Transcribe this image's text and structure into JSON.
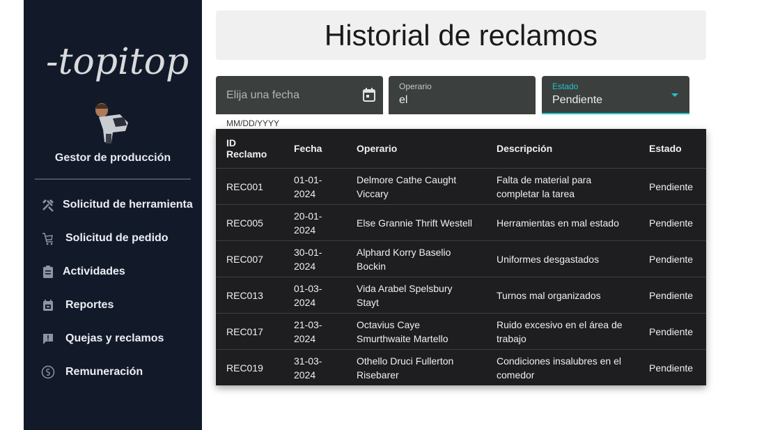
{
  "brand": {
    "logo_text": "-topitop"
  },
  "user": {
    "role": "Gestor de producción"
  },
  "nav": [
    {
      "label": "Solicitud de herramienta",
      "icon": "tools-icon"
    },
    {
      "label": "Solicitud de pedido",
      "icon": "cart-icon"
    },
    {
      "label": "Actividades",
      "icon": "clipboard-icon"
    },
    {
      "label": "Reportes",
      "icon": "calendar-report-icon"
    },
    {
      "label": "Quejas y reclamos",
      "icon": "feedback-icon"
    },
    {
      "label": "Remuneración",
      "icon": "money-icon"
    }
  ],
  "page": {
    "title": "Historial de reclamos"
  },
  "filters": {
    "date": {
      "placeholder": "Elija una fecha",
      "hint": "MM/DD/YYYY"
    },
    "operario": {
      "label": "Operario",
      "value": "el"
    },
    "estado": {
      "label": "Estado",
      "value": "Pendiente"
    }
  },
  "table": {
    "headers": [
      "ID Reclamo",
      "Fecha",
      "Operario",
      "Descripción",
      "Estado"
    ],
    "rows": [
      {
        "id": "REC001",
        "fecha": "01-01-2024",
        "operario": "Delmore Cathe Caught Viccary",
        "descripcion": "Falta de material para completar la tarea",
        "estado": "Pendiente"
      },
      {
        "id": "REC005",
        "fecha": "20-01-2024",
        "operario": "Else Grannie Thrift Westell",
        "descripcion": "Herramientas en mal estado",
        "estado": "Pendiente"
      },
      {
        "id": "REC007",
        "fecha": "30-01-2024",
        "operario": "Alphard Korry Baselio Bockin",
        "descripcion": "Uniformes desgastados",
        "estado": "Pendiente"
      },
      {
        "id": "REC013",
        "fecha": "01-03-2024",
        "operario": "Vida Arabel Spelsbury Stayt",
        "descripcion": "Turnos mal organizados",
        "estado": "Pendiente"
      },
      {
        "id": "REC017",
        "fecha": "21-03-2024",
        "operario": "Octavius Caye Smurthwaite Martello",
        "descripcion": "Ruido excesivo en el área de trabajo",
        "estado": "Pendiente"
      },
      {
        "id": "REC019",
        "fecha": "31-03-2024",
        "operario": "Othello Druci Fullerton Risebarer",
        "descripcion": "Condiciones insalubres en el comedor",
        "estado": "Pendiente"
      }
    ]
  },
  "colors": {
    "sidebar": "#121a2a",
    "accent": "#23c4c9",
    "field": "#3b3f3e",
    "table": "#1e1e20"
  }
}
